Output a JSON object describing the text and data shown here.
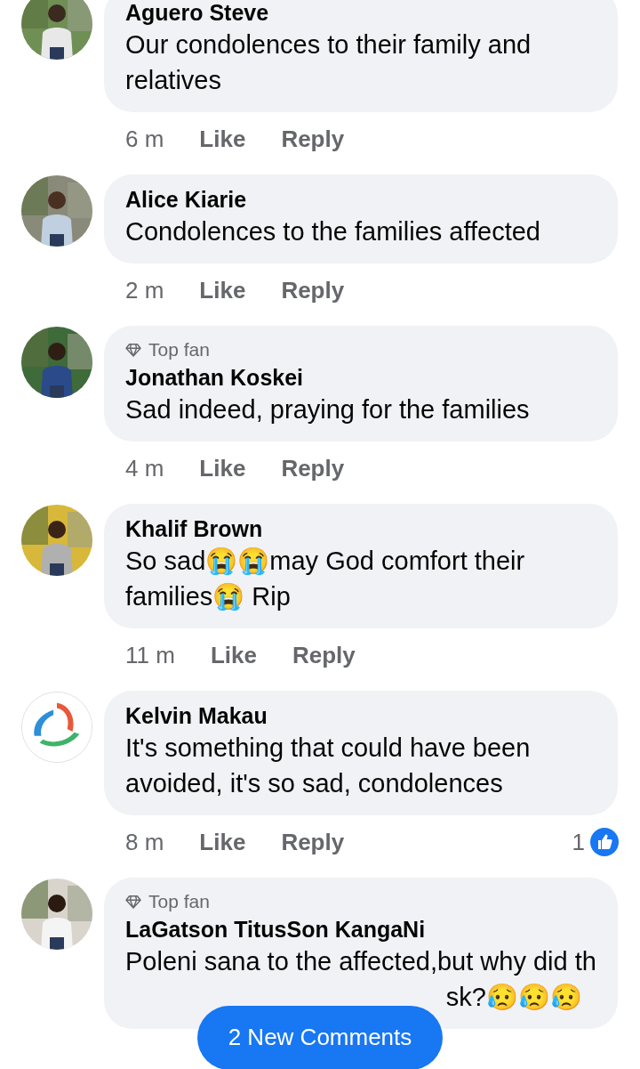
{
  "comments": [
    {
      "name": "Aguero Steve",
      "text": [
        "Our condolences to their family and relatives"
      ],
      "time": "6 m",
      "like": "Like",
      "reply": "Reply"
    },
    {
      "name": "Alice Kiarie",
      "text": [
        "Condolences to the families affected"
      ],
      "time": "2 m",
      "like": "Like",
      "reply": "Reply"
    },
    {
      "name": "Jonathan Koskei",
      "badge": "Top fan",
      "text": [
        "Sad indeed, praying for the families"
      ],
      "time": "4 m",
      "like": "Like",
      "reply": "Reply"
    },
    {
      "name": "Khalif Brown",
      "text": [
        "So sad😭😭may God comfort their families😭 Rip"
      ],
      "time": "11 m",
      "like": "Like",
      "reply": "Reply"
    },
    {
      "name": "Kelvin Makau",
      "text": [
        "It's something that could have been avoided, it's so sad, condolences"
      ],
      "time": "8 m",
      "like": "Like",
      "reply": "Reply",
      "reactions": "1"
    },
    {
      "name": "LaGatson TitusSon KangaNi",
      "badge": "Top fan",
      "text": [
        "Poleni sana to the affected,but why did th",
        "sk?😥😥😥"
      ]
    }
  ],
  "new_comments_button": "2 New Comments"
}
